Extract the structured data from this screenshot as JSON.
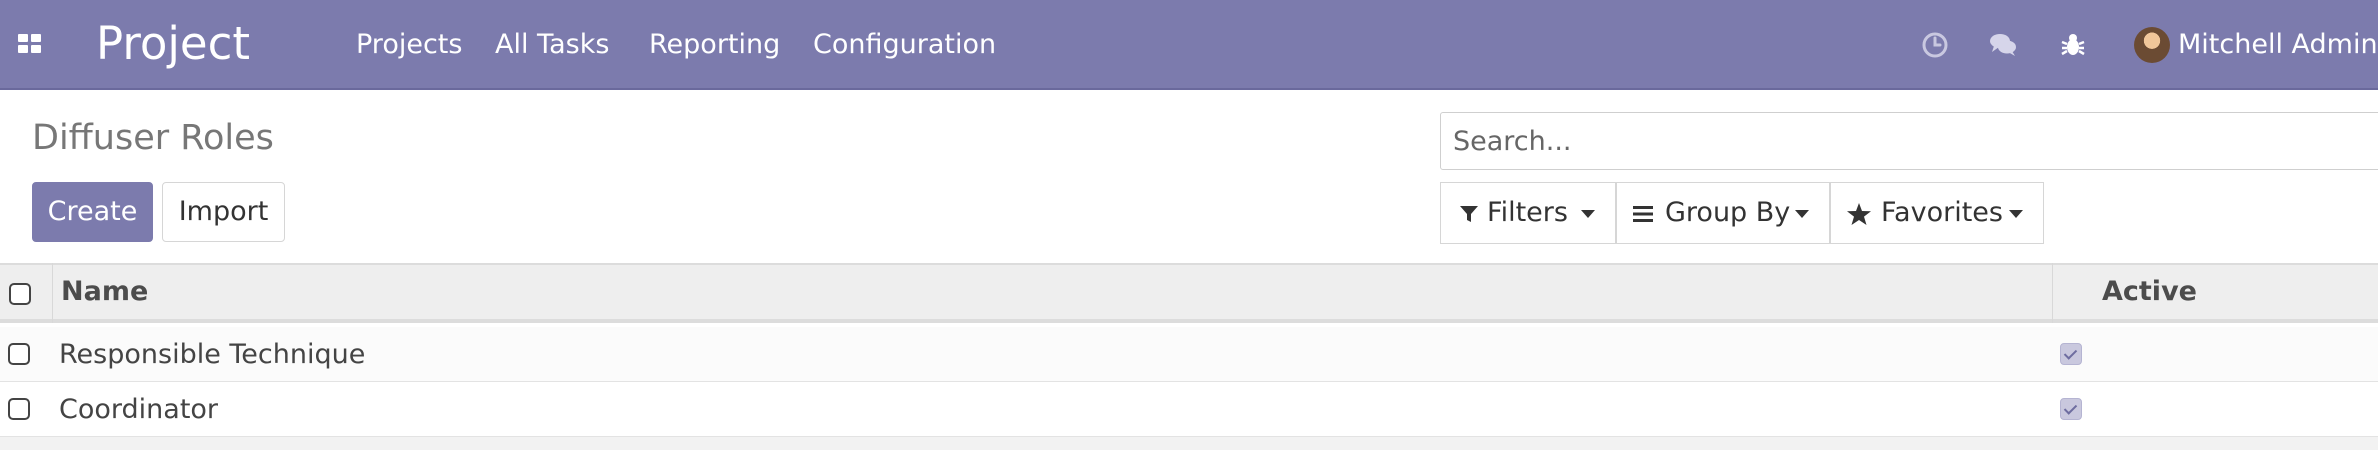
{
  "navbar": {
    "brand": "Project",
    "menu": [
      "Projects",
      "All Tasks",
      "Reporting",
      "Configuration"
    ],
    "user": "Mitchell Admin",
    "icons": [
      "apps-grid-icon",
      "clock-icon",
      "chat-icon",
      "bug-icon"
    ],
    "color": "#7c7bad"
  },
  "page": {
    "title": "Diffuser Roles",
    "create_label": "Create",
    "import_label": "Import"
  },
  "search": {
    "placeholder": "Search...",
    "filters_label": "Filters",
    "groupby_label": "Group By",
    "favorites_label": "Favorites"
  },
  "table": {
    "columns": [
      "Name",
      "Active"
    ],
    "rows": [
      {
        "name": "Responsible Technique",
        "active": true
      },
      {
        "name": "Coordinator",
        "active": true
      }
    ]
  }
}
